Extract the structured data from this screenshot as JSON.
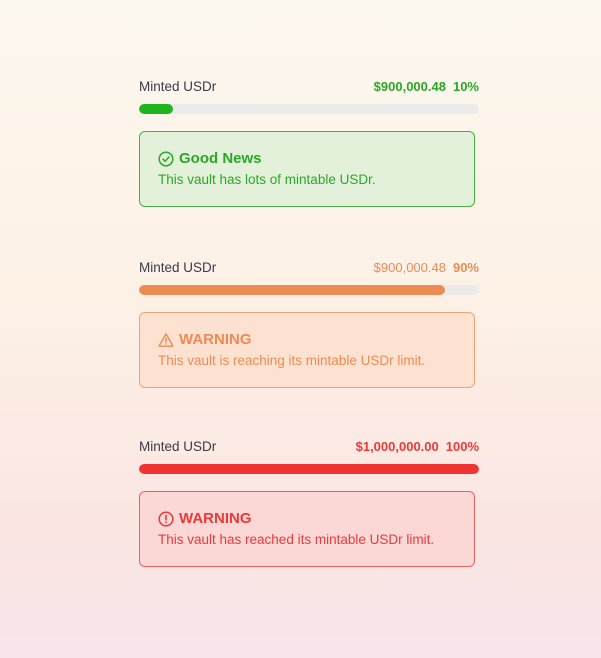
{
  "blocks": [
    {
      "label": "Minted USDr",
      "amount": "$900,000.48",
      "percent_text": "10%",
      "fill_fraction": 0.1,
      "color": "#1fb520",
      "alert": {
        "icon": "check-circle-icon",
        "title": "Good News",
        "message": "This vault has lots of mintable USDr."
      }
    },
    {
      "label": "Minted USDr",
      "amount": "$900,000.48",
      "percent_text": "90%",
      "fill_fraction": 0.9,
      "color": "#ec8b54",
      "alert": {
        "icon": "warning-triangle-icon",
        "title": "WARNING",
        "message": "This vault is reaching its mintable USDr limit."
      }
    },
    {
      "label": "Minted USDr",
      "amount": "$1,000,000.00",
      "percent_text": "100%",
      "fill_fraction": 1.0,
      "color": "#f03434",
      "alert": {
        "icon": "alert-circle-icon",
        "title": "WARNING",
        "message": "This vault has reached its mintable USDr limit."
      }
    }
  ]
}
